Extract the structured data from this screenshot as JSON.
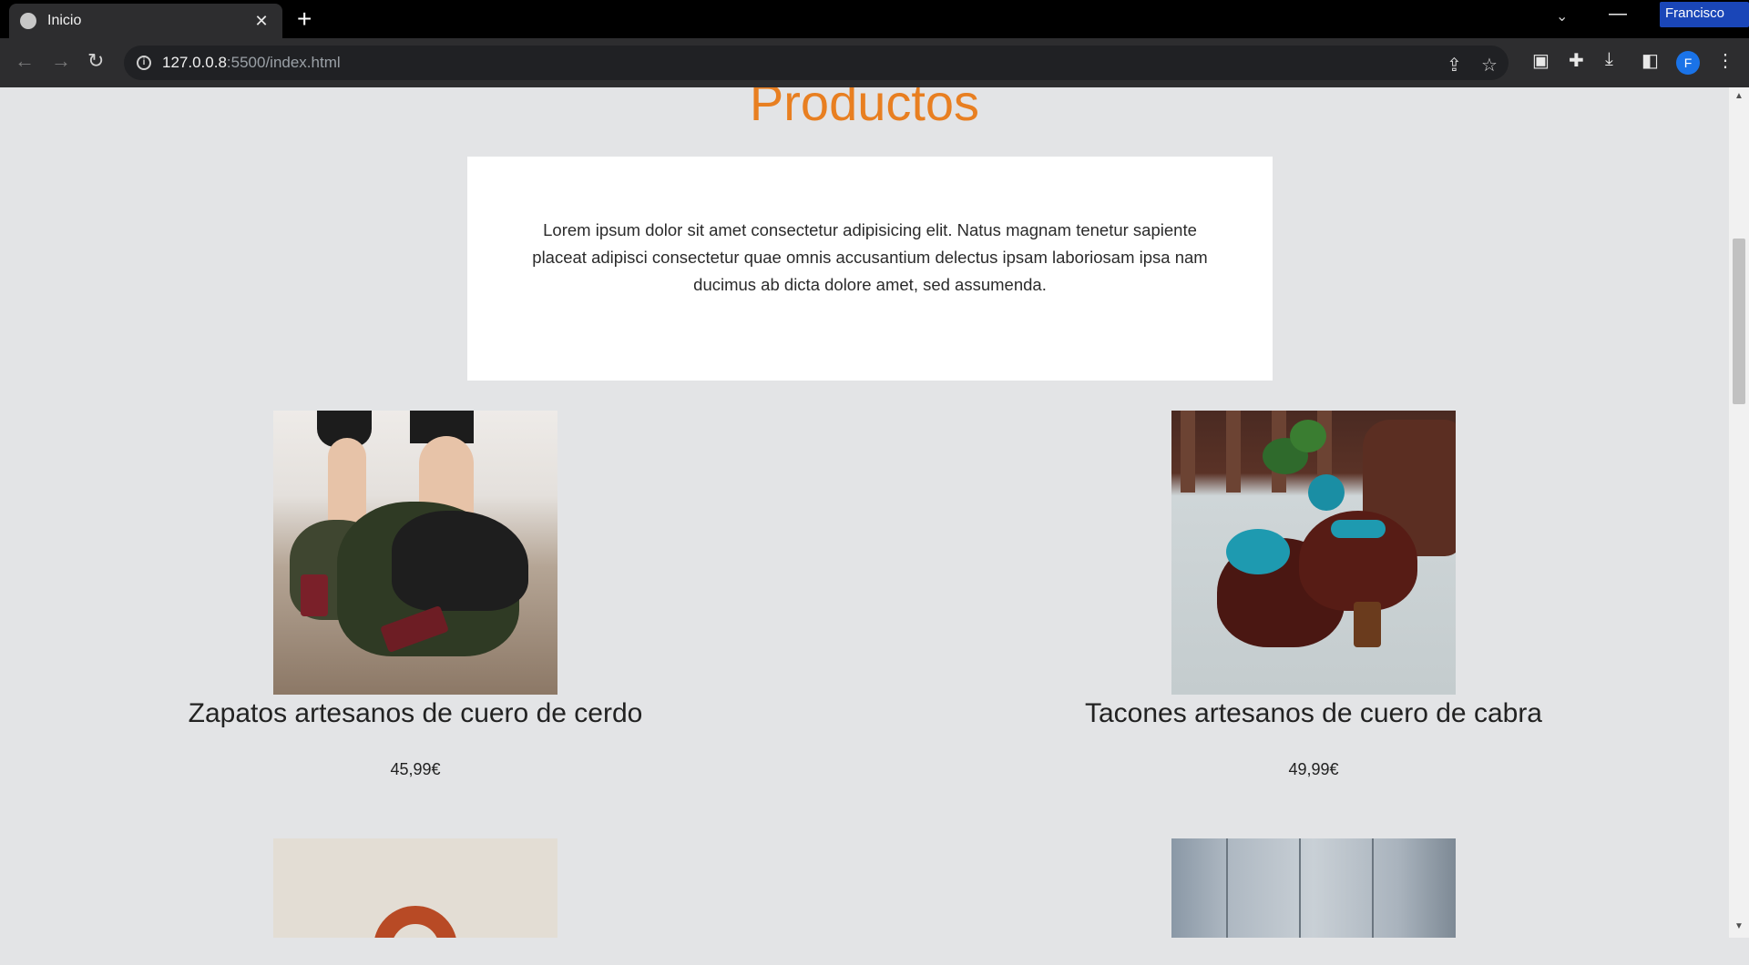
{
  "browser": {
    "tab_title": "Inicio",
    "profile_name": "Francisco",
    "url_host": "127.0.0.8",
    "url_path": ":5500/index.html",
    "avatar_letter": "F"
  },
  "page": {
    "title": "Productos",
    "intro": "Lorem ipsum dolor sit amet consectetur adipisicing elit. Natus magnam tenetur sapiente placeat adipisci consectetur quae omnis accusantium delectus ipsam laboriosam ipsa nam ducimus ab dicta dolore amet, sed assumenda."
  },
  "products": [
    {
      "name": "Zapatos artesanos de cuero de cerdo",
      "price": "45,99€"
    },
    {
      "name": "Tacones artesanos de cuero de cabra",
      "price": "49,99€"
    }
  ],
  "colors": {
    "accent": "#e87f21",
    "page_bg": "#e3e4e6"
  }
}
